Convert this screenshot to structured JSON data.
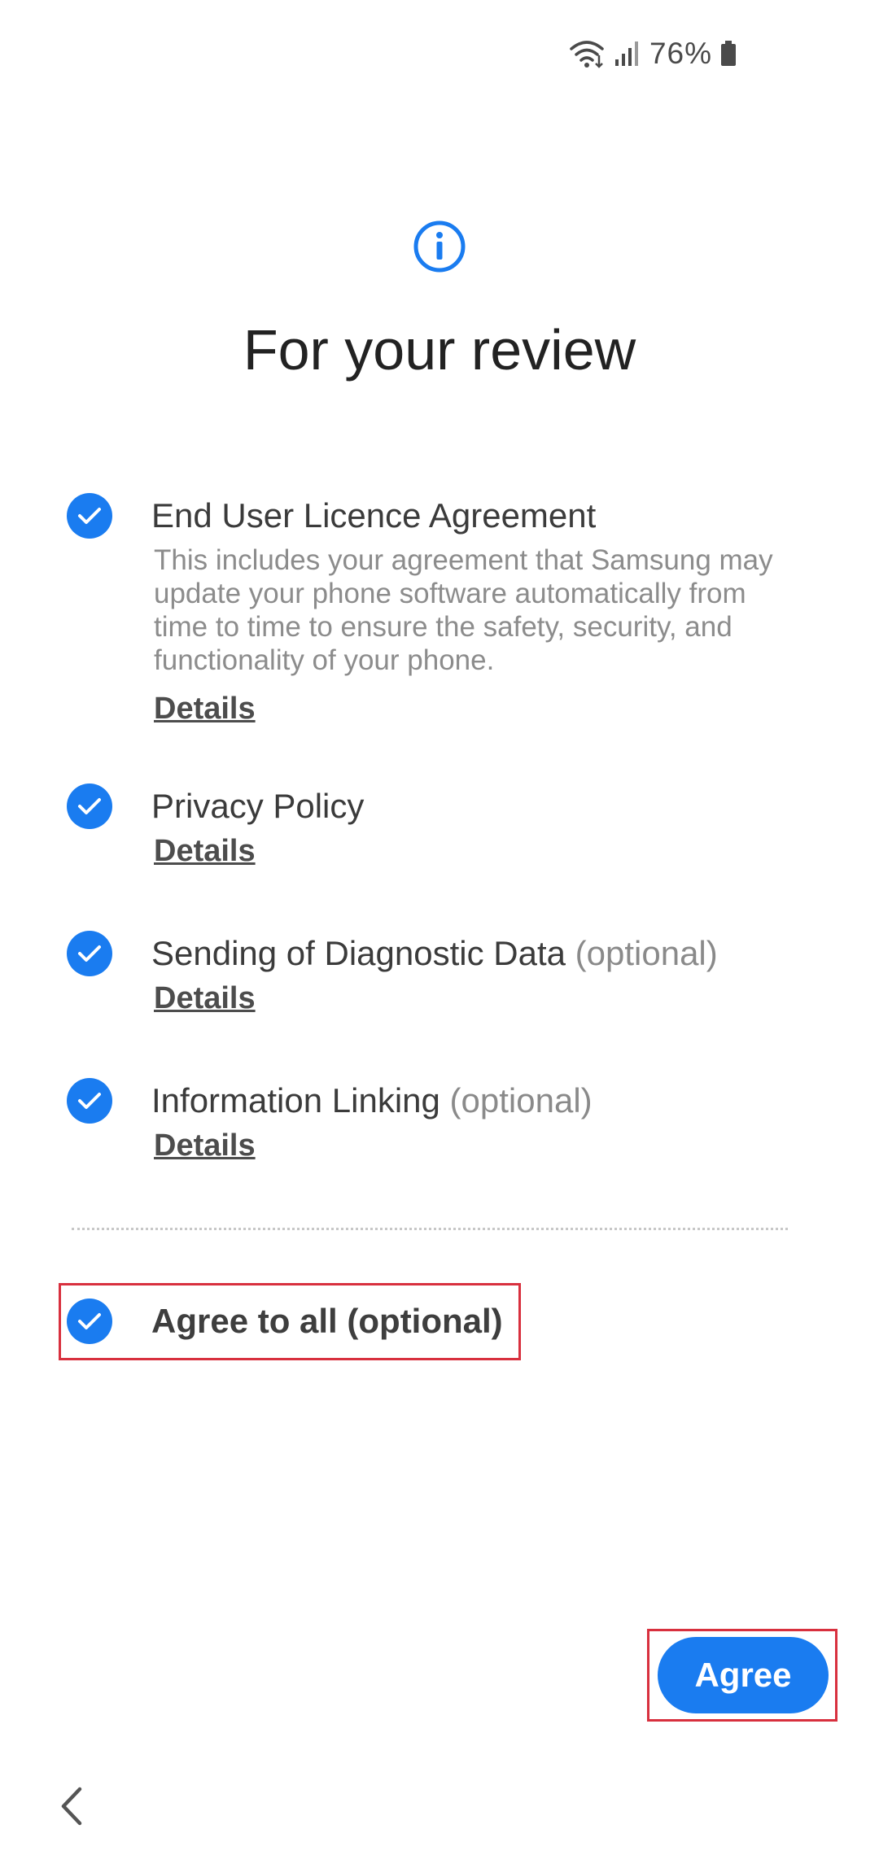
{
  "status_bar": {
    "battery_percent": "76%",
    "icons": [
      "wifi-icon",
      "signal-icon",
      "battery-icon"
    ]
  },
  "header": {
    "icon": "info-icon",
    "title": "For your review"
  },
  "items": [
    {
      "title": "End User Licence Agreement",
      "suffix": "",
      "description": "This includes your agreement that Samsung may update your phone software automatically from time to time to ensure the safety, security, and functionality of your phone.",
      "details_label": "Details",
      "checked": true
    },
    {
      "title": "Privacy Policy",
      "suffix": "",
      "details_label": "Details",
      "checked": true
    },
    {
      "title": "Sending of Diagnostic Data",
      "suffix": "(optional)",
      "details_label": "Details",
      "checked": true
    },
    {
      "title": "Information Linking",
      "suffix": "(optional)",
      "details_label": "Details",
      "checked": true
    }
  ],
  "agree_all": {
    "label": "Agree to all (optional)",
    "checked": true
  },
  "footer": {
    "agree_label": "Agree",
    "back_icon": "chevron-left-icon"
  },
  "colors": {
    "accent": "#1a7cf0",
    "highlight_border": "#d8303e"
  }
}
